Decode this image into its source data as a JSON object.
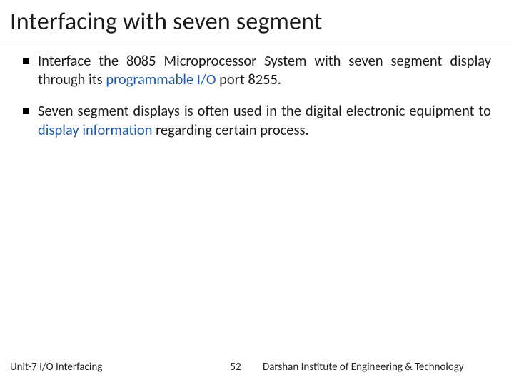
{
  "title": "Interfacing with seven segment",
  "bullets": [
    {
      "pre": "Interface the 8085 Microprocessor System with seven segment display through its ",
      "kw": "programmable I/O",
      "post": " port 8255."
    },
    {
      "pre": "Seven segment displays is often used in the digital electronic equipment to ",
      "kw": "display information",
      "post": " regarding certain process."
    }
  ],
  "footer": {
    "left": "Unit-7 I/O Interfacing",
    "page": "52",
    "right": "Darshan Institute of Engineering & Technology"
  }
}
